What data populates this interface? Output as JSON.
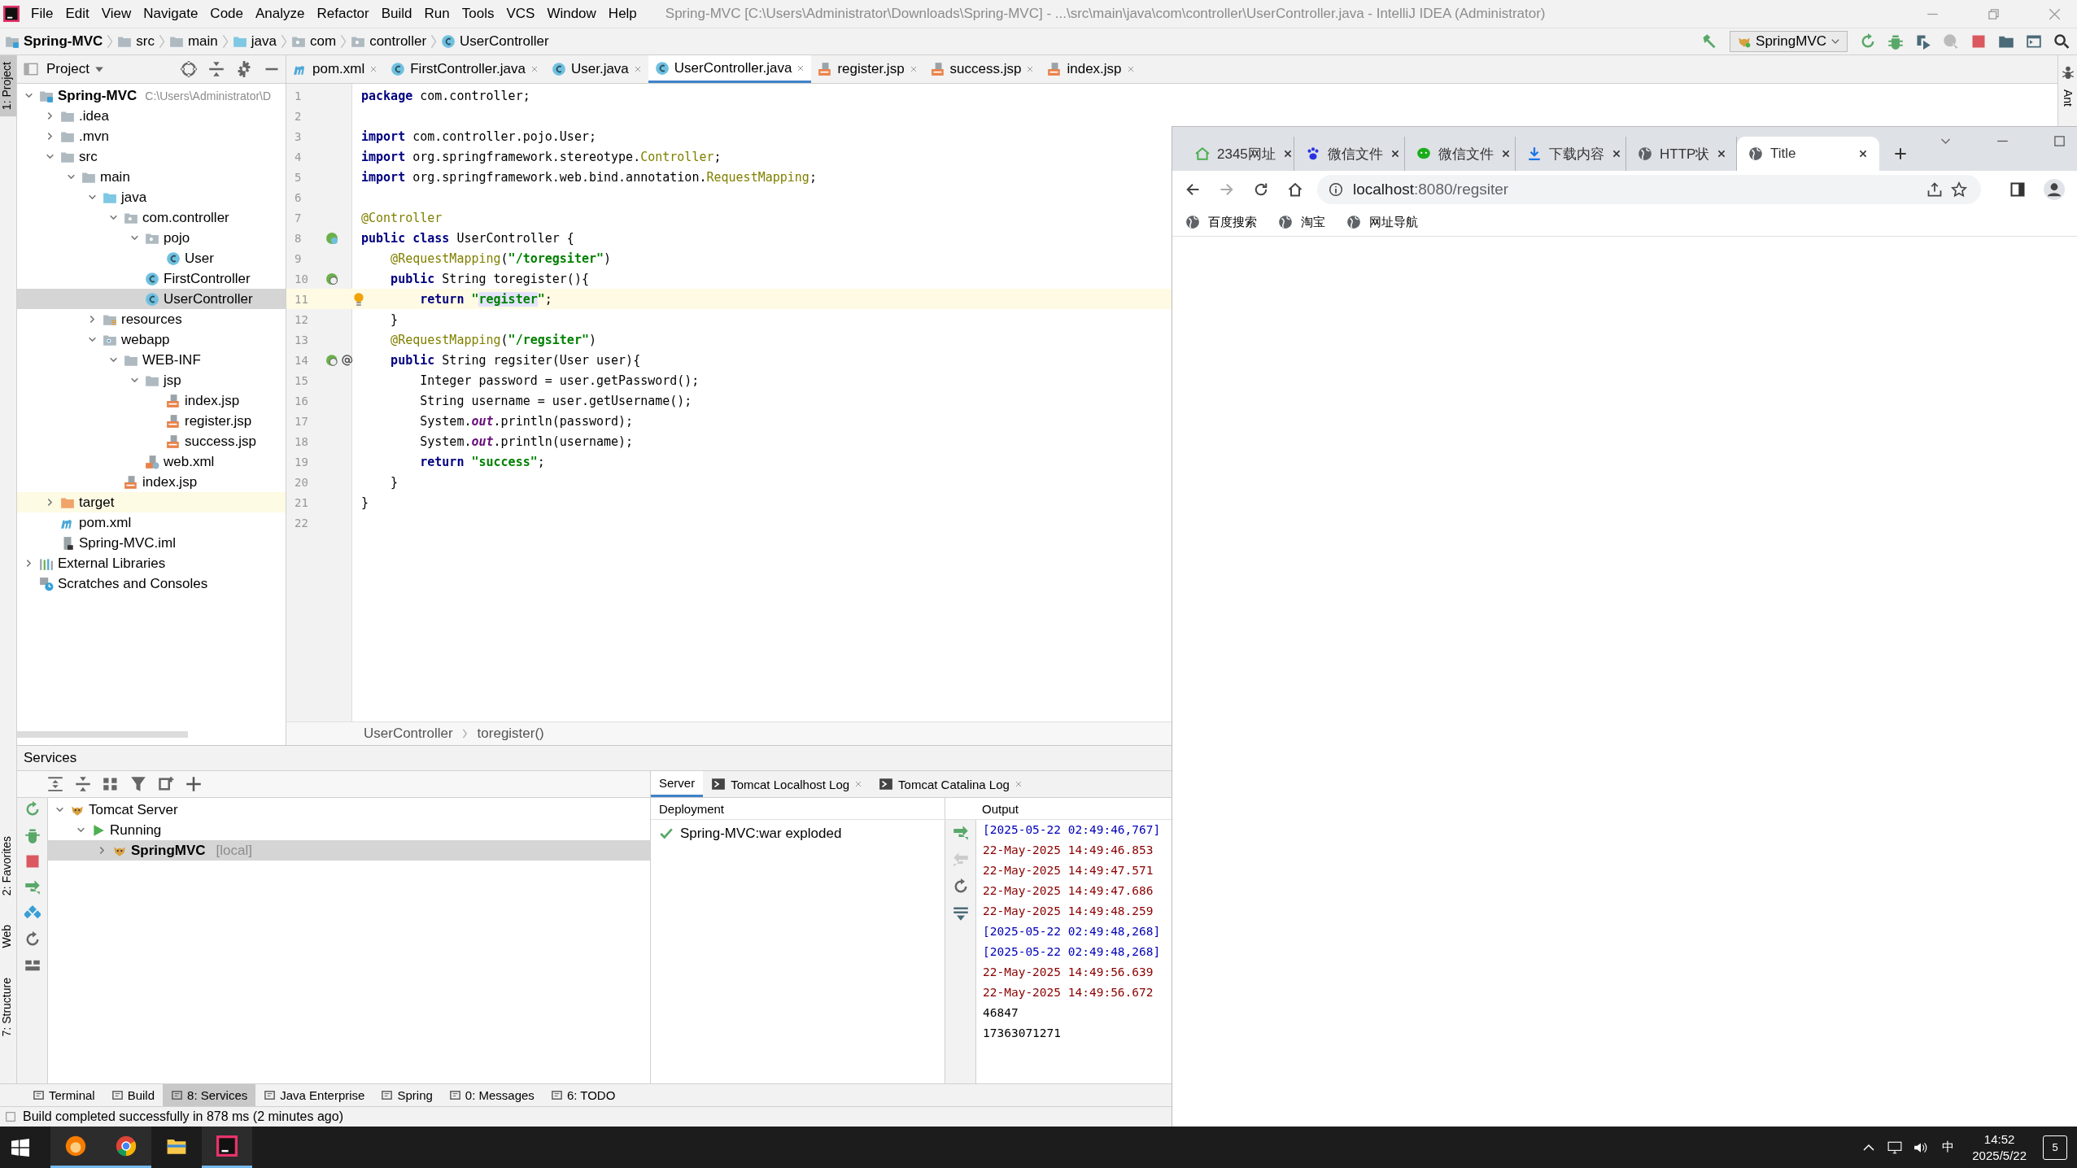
{
  "window": {
    "title": "Spring-MVC [C:\\Users\\Administrator\\Downloads\\Spring-MVC] - ...\\src\\main\\java\\com\\controller\\UserController.java - IntelliJ IDEA (Administrator)"
  },
  "menu": [
    "File",
    "Edit",
    "View",
    "Navigate",
    "Code",
    "Analyze",
    "Refactor",
    "Build",
    "Run",
    "Tools",
    "VCS",
    "Window",
    "Help"
  ],
  "nav_bar": {
    "breadcrumbs": [
      {
        "label": "Spring-MVC",
        "kind": "module"
      },
      {
        "label": "src",
        "kind": "folder"
      },
      {
        "label": "main",
        "kind": "folder"
      },
      {
        "label": "java",
        "kind": "source"
      },
      {
        "label": "com",
        "kind": "package"
      },
      {
        "label": "controller",
        "kind": "package"
      },
      {
        "label": "UserController",
        "kind": "class"
      }
    ],
    "run_config": "SpringMVC"
  },
  "tool_strips": {
    "left_top": [
      {
        "label": "1: Project",
        "selected": true
      }
    ],
    "left_bottom": [
      {
        "label": "2: Favorites",
        "selected": false
      },
      {
        "label": "Web",
        "selected": false
      },
      {
        "label": "7: Structure",
        "selected": false
      }
    ],
    "right": [
      {
        "label": "Ant",
        "selected": false
      }
    ]
  },
  "project": {
    "title": "Project",
    "tree": [
      {
        "label": "Spring-MVC",
        "path": "C:\\Users\\Administrator\\D",
        "kind": "module",
        "expanded": true,
        "selected": false,
        "children": [
          {
            "label": ".idea",
            "kind": "folder",
            "expanded": false,
            "selected": false
          },
          {
            "label": ".mvn",
            "kind": "folder",
            "expanded": false,
            "selected": false
          },
          {
            "label": "src",
            "kind": "folder",
            "expanded": true,
            "selected": false,
            "children": [
              {
                "label": "main",
                "kind": "folder",
                "expanded": true,
                "selected": false,
                "children": [
                  {
                    "label": "java",
                    "kind": "source",
                    "expanded": true,
                    "selected": false,
                    "children": [
                      {
                        "label": "com.controller",
                        "kind": "package",
                        "expanded": true,
                        "selected": false,
                        "children": [
                          {
                            "label": "pojo",
                            "kind": "package",
                            "expanded": true,
                            "selected": false,
                            "children": [
                              {
                                "label": "User",
                                "kind": "class",
                                "selected": false
                              }
                            ]
                          },
                          {
                            "label": "FirstController",
                            "kind": "class",
                            "selected": false
                          },
                          {
                            "label": "UserController",
                            "kind": "class",
                            "selected": true
                          }
                        ]
                      }
                    ]
                  },
                  {
                    "label": "resources",
                    "kind": "resources",
                    "expanded": false,
                    "selected": false
                  },
                  {
                    "label": "webapp",
                    "kind": "webapp",
                    "expanded": true,
                    "selected": false,
                    "children": [
                      {
                        "label": "WEB-INF",
                        "kind": "folder",
                        "expanded": true,
                        "selected": false,
                        "children": [
                          {
                            "label": "jsp",
                            "kind": "folder",
                            "expanded": true,
                            "selected": false,
                            "children": [
                              {
                                "label": "index.jsp",
                                "kind": "jsp",
                                "selected": false
                              },
                              {
                                "label": "register.jsp",
                                "kind": "jsp",
                                "selected": false
                              },
                              {
                                "label": "success.jsp",
                                "kind": "jsp",
                                "selected": false
                              }
                            ]
                          },
                          {
                            "label": "web.xml",
                            "kind": "xml",
                            "selected": false
                          }
                        ]
                      },
                      {
                        "label": "index.jsp",
                        "kind": "jsp",
                        "selected": false
                      }
                    ]
                  }
                ]
              }
            ]
          },
          {
            "label": "target",
            "kind": "excluded",
            "expanded": false,
            "selected": false
          },
          {
            "label": "pom.xml",
            "kind": "maven",
            "selected": false
          },
          {
            "label": "Spring-MVC.iml",
            "kind": "iml",
            "selected": false
          }
        ]
      },
      {
        "label": "External Libraries",
        "kind": "libraries",
        "expanded": false,
        "selected": false
      },
      {
        "label": "Scratches and Consoles",
        "kind": "scratches",
        "selected": false
      }
    ]
  },
  "editor": {
    "tabs": [
      {
        "label": "pom.xml",
        "kind": "maven",
        "selected": false
      },
      {
        "label": "FirstController.java",
        "kind": "class",
        "selected": false
      },
      {
        "label": "User.java",
        "kind": "class",
        "selected": false
      },
      {
        "label": "UserController.java",
        "kind": "class",
        "selected": true
      },
      {
        "label": "register.jsp",
        "kind": "jsp",
        "selected": false
      },
      {
        "label": "success.jsp",
        "kind": "jsp",
        "selected": false
      },
      {
        "label": "index.jsp",
        "kind": "jsp",
        "selected": false
      }
    ],
    "lines": [
      {
        "n": "1",
        "kind": "top",
        "current": false,
        "tokens": [
          {
            "kind": "kw",
            "t": "package"
          },
          {
            "t": " com.controller;"
          }
        ]
      },
      {
        "n": "2",
        "current": false
      },
      {
        "n": "3",
        "kind": "top",
        "current": false,
        "tokens": [
          {
            "kind": "kw",
            "t": "import"
          },
          {
            "t": " com.controller.pojo.User;"
          }
        ]
      },
      {
        "n": "4",
        "kind": "top",
        "current": false,
        "tokens": [
          {
            "kind": "kw",
            "t": "import"
          },
          {
            "t": " org.springframework.stereotype."
          },
          {
            "kind": "ref",
            "t": "Controller"
          },
          {
            "t": ";"
          }
        ]
      },
      {
        "n": "5",
        "kind": "top",
        "current": false,
        "tokens": [
          {
            "kind": "kw",
            "t": "import"
          },
          {
            "t": " org.springframework.web.bind.annotation."
          },
          {
            "kind": "ref",
            "t": "RequestMapping"
          },
          {
            "t": ";"
          }
        ]
      },
      {
        "n": "6",
        "current": false
      },
      {
        "n": "7",
        "kind": "top",
        "current": false,
        "tokens": [
          {
            "kind": "ann",
            "t": "@Controller"
          }
        ]
      },
      {
        "n": "8",
        "kind": "top",
        "current": false,
        "gutter": {
          "kind": "bean"
        },
        "tokens": [
          {
            "kind": "kw",
            "t": "public class"
          },
          {
            "t": " UserController {"
          }
        ]
      },
      {
        "n": "9",
        "kind": "class",
        "current": false,
        "tokens": [
          {
            "kind": "ann",
            "t": "@RequestMapping"
          },
          {
            "t": "("
          },
          {
            "kind": "str",
            "t": "\"/toregsiter\""
          },
          {
            "t": ")"
          }
        ]
      },
      {
        "n": "10",
        "kind": "class",
        "current": false,
        "gutter": {
          "kind": "mapping"
        },
        "tokens": [
          {
            "kind": "kw",
            "t": "public"
          },
          {
            "t": " String toregister(){"
          }
        ]
      },
      {
        "n": "11",
        "kind": "method",
        "current": true,
        "tokens": [
          {
            "kind": "kw",
            "t": "return"
          },
          {
            "kind": "str",
            "t": " \""
          },
          {
            "kind": "str-hl",
            "t": "register"
          },
          {
            "kind": "str",
            "t": "\""
          },
          {
            "t": ";"
          }
        ]
      },
      {
        "n": "12",
        "kind": "class",
        "current": false,
        "tokens": [
          {
            "t": "}"
          }
        ]
      },
      {
        "n": "13",
        "kind": "class",
        "current": false,
        "tokens": [
          {
            "kind": "ann",
            "t": "@RequestMapping"
          },
          {
            "t": "("
          },
          {
            "kind": "str",
            "t": "\"/regsiter\""
          },
          {
            "t": ")"
          }
        ]
      },
      {
        "n": "14",
        "kind": "class",
        "current": false,
        "gutter": {
          "kind": "mapping-inject"
        },
        "tokens": [
          {
            "kind": "kw",
            "t": "public"
          },
          {
            "t": " String regsiter(User user){"
          }
        ]
      },
      {
        "n": "15",
        "kind": "method",
        "current": false,
        "tokens": [
          {
            "t": "Integer password = user.getPassword();"
          }
        ]
      },
      {
        "n": "16",
        "kind": "method",
        "current": false,
        "tokens": [
          {
            "t": "String username = user.getUsername();"
          }
        ]
      },
      {
        "n": "17",
        "kind": "method",
        "current": false,
        "tokens": [
          {
            "t": "System."
          },
          {
            "kind": "field",
            "t": "out"
          },
          {
            "t": ".println(password);"
          }
        ]
      },
      {
        "n": "18",
        "kind": "method",
        "current": false,
        "tokens": [
          {
            "t": "System."
          },
          {
            "kind": "field",
            "t": "out"
          },
          {
            "t": ".println(username);"
          }
        ]
      },
      {
        "n": "19",
        "kind": "method",
        "current": false,
        "tokens": [
          {
            "kind": "kw",
            "t": "return"
          },
          {
            "kind": "str",
            "t": " \"success\""
          },
          {
            "t": ";"
          }
        ]
      },
      {
        "n": "20",
        "kind": "class",
        "current": false,
        "tokens": [
          {
            "t": "}"
          }
        ]
      },
      {
        "n": "21",
        "kind": "top",
        "current": false,
        "tokens": [
          {
            "t": "}"
          }
        ]
      },
      {
        "n": "22",
        "current": false
      }
    ],
    "breadcrumb": [
      "UserController",
      "toregister()"
    ]
  },
  "services": {
    "title": "Services",
    "tree": [
      {
        "label": "Tomcat Server",
        "kind": "server",
        "expanded": true,
        "selected": false,
        "children": [
          {
            "label": "Running",
            "kind": "running",
            "expanded": true,
            "selected": false,
            "children": [
              {
                "label": "SpringMVC",
                "suffix": "[local]",
                "kind": "server",
                "expanded": false,
                "selected": true
              }
            ]
          }
        ]
      }
    ],
    "tabs": [
      {
        "label": "Server",
        "selected": true,
        "closable": false
      },
      {
        "label": "Tomcat Localhost Log",
        "selected": false,
        "closable": true
      },
      {
        "label": "Tomcat Catalina Log",
        "selected": false,
        "closable": true
      }
    ],
    "deployment_header": "Deployment",
    "deployments": [
      "Spring-MVC:war exploded"
    ],
    "output_header": "Output",
    "output": [
      {
        "kind": "info",
        "t": "[2025-05-22 02:49:46,767]"
      },
      {
        "kind": "log",
        "t": "22-May-2025 14:49:46.853"
      },
      {
        "kind": "log",
        "t": "22-May-2025 14:49:47.571"
      },
      {
        "kind": "log",
        "t": "22-May-2025 14:49:47.686"
      },
      {
        "kind": "log",
        "t": "22-May-2025 14:49:48.259"
      },
      {
        "kind": "info",
        "t": "[2025-05-22 02:49:48,268]"
      },
      {
        "kind": "info",
        "t": "[2025-05-22 02:49:48,268]"
      },
      {
        "kind": "log",
        "t": "22-May-2025 14:49:56.639"
      },
      {
        "kind": "log",
        "t": "22-May-2025 14:49:56.672"
      },
      {
        "kind": "plain",
        "t": "46847"
      },
      {
        "kind": "plain",
        "t": "17363071271"
      }
    ]
  },
  "tool_tabs": [
    {
      "label": "Terminal",
      "selected": false
    },
    {
      "label": "Build",
      "selected": false
    },
    {
      "label": "8: Services",
      "selected": true
    },
    {
      "label": "Java Enterprise",
      "selected": false
    },
    {
      "label": "Spring",
      "selected": false
    },
    {
      "label": "0: Messages",
      "selected": false
    },
    {
      "label": "6: TODO",
      "selected": false
    }
  ],
  "status_bar": "Build completed successfully in 878 ms (2 minutes ago)",
  "browser": {
    "tabs": [
      {
        "title": "2345网址",
        "kind": "house",
        "selected": false
      },
      {
        "title": "微信文件",
        "kind": "paw",
        "selected": false
      },
      {
        "title": "微信文件",
        "kind": "chat",
        "selected": false
      },
      {
        "title": "下载内容",
        "kind": "download",
        "selected": false
      },
      {
        "title": "HTTP状",
        "kind": "globe",
        "selected": false
      },
      {
        "title": "Title",
        "kind": "globe",
        "selected": true
      }
    ],
    "address": {
      "host": "localhost",
      "rest": ":8080/regsiter"
    },
    "bookmarks": [
      "百度搜索",
      "淘宝",
      "网址导航"
    ]
  },
  "taskbar": {
    "apps": [
      {
        "kind": "fox",
        "running": true
      },
      {
        "kind": "chrome",
        "running": true
      },
      {
        "kind": "files",
        "running": false
      },
      {
        "kind": "ide",
        "running": true
      }
    ],
    "ime": "中",
    "time": "14:52",
    "date": "2025/5/22",
    "notifications": "5"
  }
}
